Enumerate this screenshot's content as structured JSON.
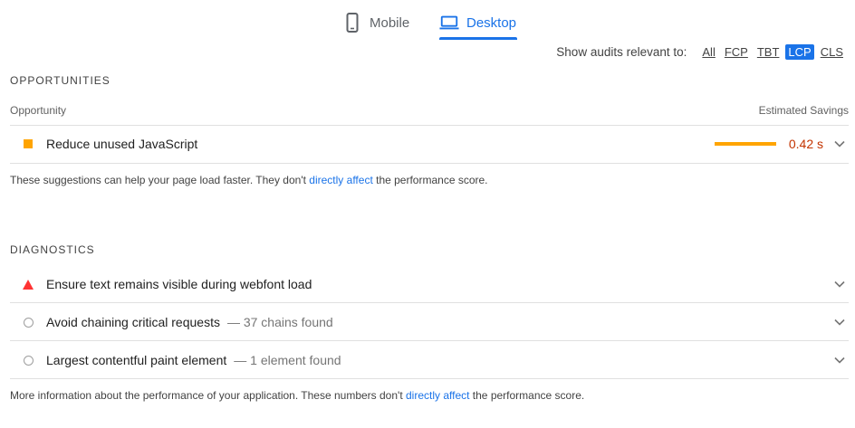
{
  "tabs": {
    "mobile": {
      "label": "Mobile",
      "icon": "smartphone-icon"
    },
    "desktop": {
      "label": "Desktop",
      "icon": "laptop-icon",
      "selected": true
    }
  },
  "filter": {
    "label": "Show audits relevant to:",
    "chips": [
      "All",
      "FCP",
      "TBT",
      "LCP",
      "CLS"
    ],
    "active": "LCP"
  },
  "opportunities": {
    "title": "OPPORTUNITIES",
    "col_opportunity": "Opportunity",
    "col_savings": "Estimated Savings",
    "items": [
      {
        "title": "Reduce unused JavaScript",
        "savings": "0.42 s",
        "status": "average",
        "marker": "orange-square-icon"
      }
    ],
    "note_pre": "These suggestions can help your page load faster. They don't ",
    "note_link": "directly affect",
    "note_post": " the performance score."
  },
  "diagnostics": {
    "title": "DIAGNOSTICS",
    "items": [
      {
        "title": "Ensure text remains visible during webfont load",
        "detail": "",
        "status": "fail",
        "marker": "red-triangle-icon"
      },
      {
        "title": "Avoid chaining critical requests",
        "detail": "— 37 chains found",
        "status": "informative",
        "marker": "gray-circle-icon"
      },
      {
        "title": "Largest contentful paint element",
        "detail": "— 1 element found",
        "status": "informative",
        "marker": "gray-circle-icon"
      }
    ],
    "note_pre": "More information about the performance of your application. These numbers don't ",
    "note_link": "directly affect",
    "note_post": " the performance score."
  },
  "colors": {
    "accent": "#1a73e8",
    "average": "#ffa400",
    "average_text": "#c33300",
    "fail": "#ff3333",
    "informative": "#9e9e9e"
  }
}
